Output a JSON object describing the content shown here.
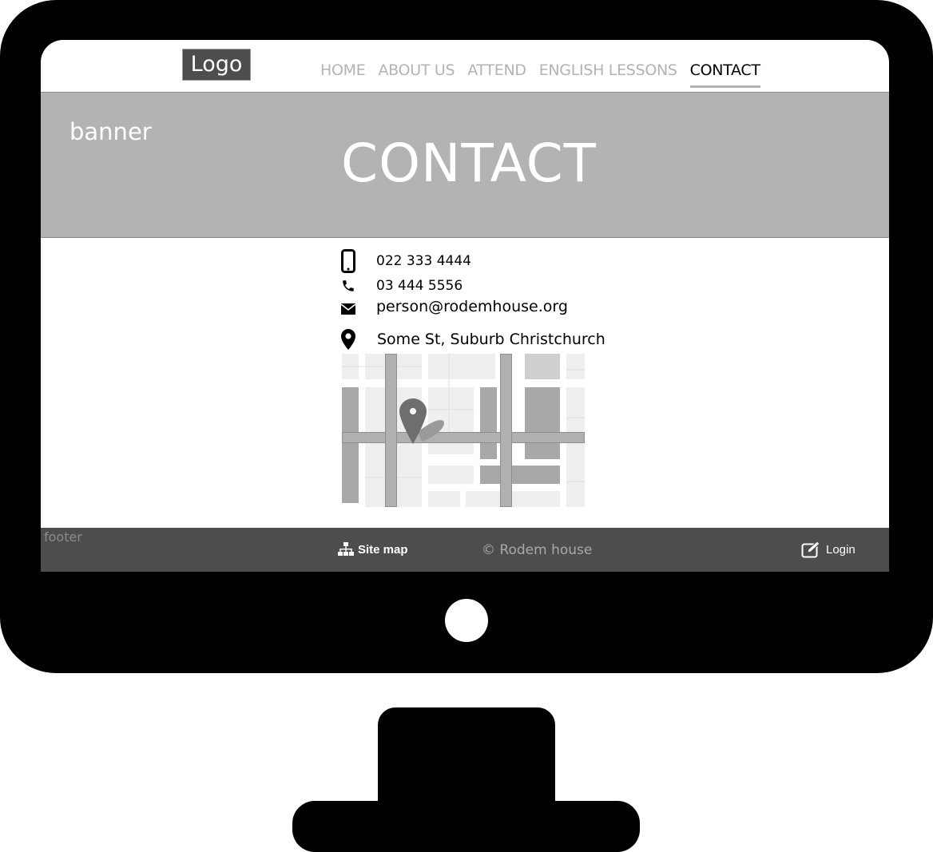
{
  "logo": {
    "label": "Logo"
  },
  "nav": {
    "items": [
      {
        "label": "HOME"
      },
      {
        "label": "ABOUT US"
      },
      {
        "label": "ATTEND"
      },
      {
        "label": "ENGLISH LESSONS"
      },
      {
        "label": "CONTACT",
        "active": true
      }
    ]
  },
  "banner": {
    "label": "banner",
    "title": "CONTACT"
  },
  "contact": {
    "mobile": "022 333 4444",
    "phone": "03 444 5556",
    "email": "person@rodemhouse.org",
    "address": "Some St, Suburb Christchurch"
  },
  "footer": {
    "label": "footer",
    "sitemap_label": "Site map",
    "copyright": "© Rodem house",
    "login_label": "Login"
  },
  "colors": {
    "banner_bg": "#b3b3b3",
    "footer_bg": "#4d4d4d",
    "nav_inactive": "#b3b3b3",
    "monitor_frame": "#000000"
  }
}
